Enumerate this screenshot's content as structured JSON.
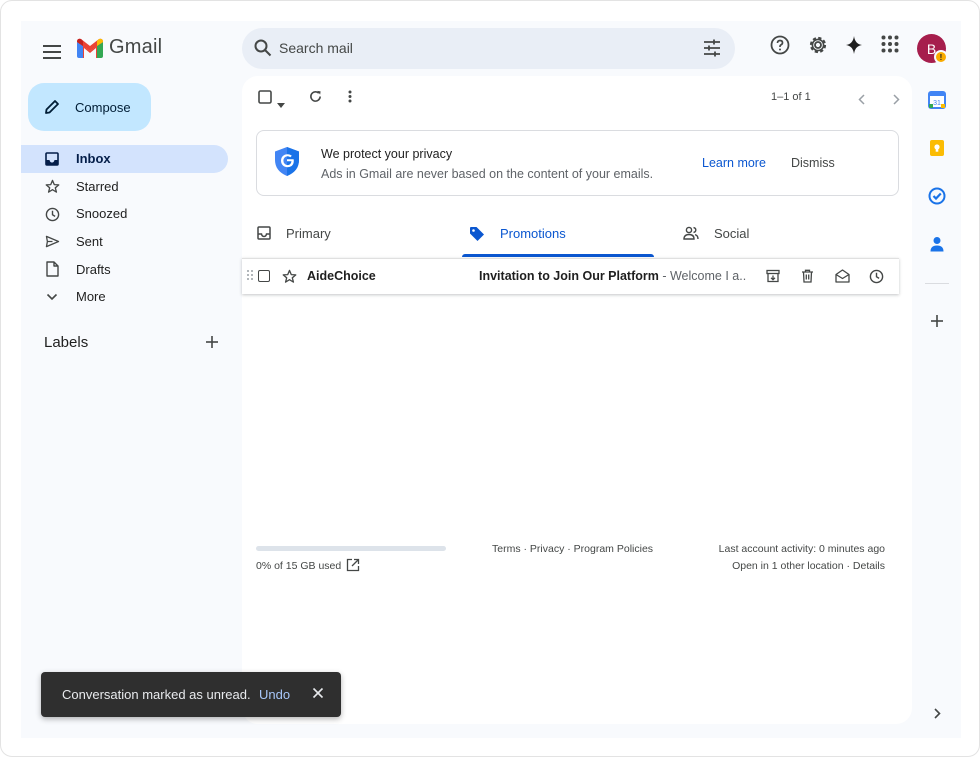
{
  "app": {
    "name": "Gmail"
  },
  "header": {
    "search_placeholder": "Search mail",
    "avatar_letter": "B",
    "avatar_badge": "!"
  },
  "compose": {
    "label": "Compose"
  },
  "sidebar": {
    "items": [
      {
        "label": "Inbox",
        "icon": "inbox-icon",
        "active": true
      },
      {
        "label": "Starred",
        "icon": "star-icon"
      },
      {
        "label": "Snoozed",
        "icon": "clock-icon"
      },
      {
        "label": "Sent",
        "icon": "send-icon"
      },
      {
        "label": "Drafts",
        "icon": "draft-icon"
      },
      {
        "label": "More",
        "icon": "chevron-down-icon"
      }
    ],
    "labels_heading": "Labels"
  },
  "toolbar": {
    "pager": "1–1 of 1"
  },
  "privacy_banner": {
    "title": "We protect your privacy",
    "subtitle": "Ads in Gmail are never based on the content of your emails.",
    "learn_more": "Learn more",
    "dismiss": "Dismiss"
  },
  "tabs": [
    {
      "label": "Primary",
      "icon": "inbox-icon"
    },
    {
      "label": "Promotions",
      "icon": "tag-icon",
      "active": true
    },
    {
      "label": "Social",
      "icon": "people-icon"
    }
  ],
  "emails": [
    {
      "sender": "AideChoice",
      "subject": "Invitation to Join Our Platform",
      "snippet": " - Welcome I a..."
    }
  ],
  "footer": {
    "storage": "0% of 15 GB used",
    "storage_used_fraction": 0,
    "legal": "Terms · Privacy · Program Policies",
    "activity": "Last account activity: 0 minutes ago",
    "other_location": "Open in 1 other location · Details"
  },
  "snackbar": {
    "message": "Conversation marked as unread.",
    "undo": "Undo"
  },
  "colors": {
    "accent": "#0b57d0",
    "compose_bg": "#c2e7ff",
    "active_nav": "#d3e3fd",
    "avatar_bg": "#a61e4d"
  }
}
